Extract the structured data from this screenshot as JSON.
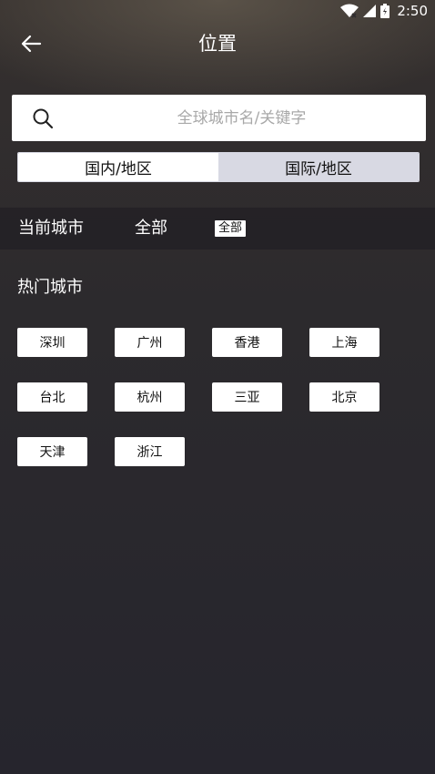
{
  "status_bar": {
    "time": "2:50",
    "icons": [
      "wifi-icon",
      "cell-signal-icon",
      "battery-icon"
    ]
  },
  "header": {
    "back_icon": "arrow-left-icon",
    "title": "位置"
  },
  "search": {
    "icon": "search-icon",
    "placeholder": "全球城市名/关键字",
    "value": ""
  },
  "segment": {
    "items": [
      {
        "label": "国内/地区",
        "selected": true
      },
      {
        "label": "国际/地区",
        "selected": false
      }
    ]
  },
  "current_city": {
    "label": "当前城市",
    "value": "全部",
    "badge": "全部"
  },
  "hot_cities": {
    "title": "热门城市",
    "items": [
      "深圳",
      "广州",
      "香港",
      "上海",
      "台北",
      "杭州",
      "三亚",
      "北京",
      "天津",
      "浙江"
    ]
  },
  "colors": {
    "background": "#2a282d",
    "segment_inactive": "#d8d9e3",
    "button_bg": "#ffffff"
  }
}
